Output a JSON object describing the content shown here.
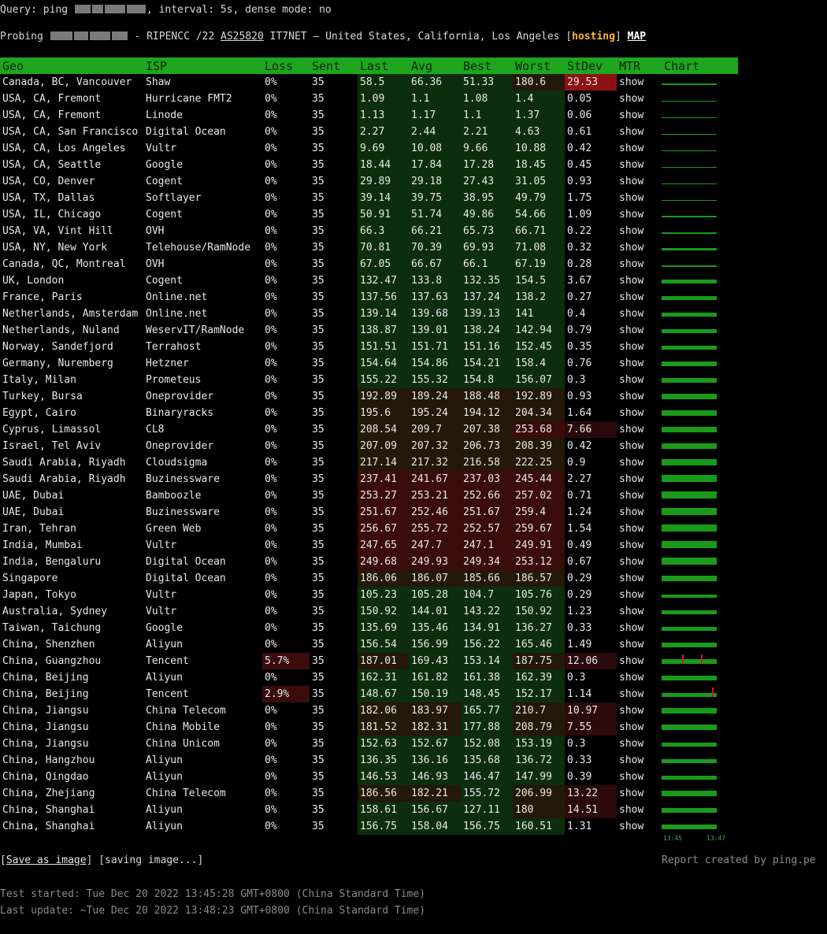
{
  "query": {
    "prefix": "Query: ping ",
    "suffix": ", interval: 5s, dense mode: no"
  },
  "probe": {
    "prefix": "Probing ",
    "network": " - RIPENCC /22 ",
    "asn": "AS25820",
    "org_location": " IT7NET — United States, California, Los Angeles ",
    "lbr": "[",
    "hosting": "hosting",
    "rbr": "]",
    "map": "MAP"
  },
  "headers": [
    "Geo",
    "ISP",
    "Loss",
    "Sent",
    "Last",
    "Avg",
    "Best",
    "Worst",
    "StDev",
    "MTR",
    "Chart"
  ],
  "rows": [
    [
      "Canada, BC, Vancouver",
      "Shaw",
      "0%",
      "35",
      "58.5",
      "66.36",
      "51.33",
      "180.6",
      "29.53"
    ],
    [
      "USA, CA, Fremont",
      "Hurricane FMT2",
      "0%",
      "35",
      "1.09",
      "1.1",
      "1.08",
      "1.4",
      "0.05"
    ],
    [
      "USA, CA, Fremont",
      "Linode",
      "0%",
      "35",
      "1.13",
      "1.17",
      "1.1",
      "1.37",
      "0.06"
    ],
    [
      "USA, CA, San Francisco",
      "Digital Ocean",
      "0%",
      "35",
      "2.27",
      "2.44",
      "2.21",
      "4.63",
      "0.61"
    ],
    [
      "USA, CA, Los Angeles",
      "Vultr",
      "0%",
      "35",
      "9.69",
      "10.08",
      "9.66",
      "10.88",
      "0.42"
    ],
    [
      "USA, CA, Seattle",
      "Google",
      "0%",
      "35",
      "18.44",
      "17.84",
      "17.28",
      "18.45",
      "0.45"
    ],
    [
      "USA, CO, Denver",
      "Cogent",
      "0%",
      "35",
      "29.89",
      "29.18",
      "27.43",
      "31.05",
      "0.93"
    ],
    [
      "USA, TX, Dallas",
      "Softlayer",
      "0%",
      "35",
      "39.14",
      "39.75",
      "38.95",
      "49.79",
      "1.75"
    ],
    [
      "USA, IL, Chicago",
      "Cogent",
      "0%",
      "35",
      "50.91",
      "51.74",
      "49.86",
      "54.66",
      "1.09"
    ],
    [
      "USA, VA, Vint Hill",
      "OVH",
      "0%",
      "35",
      "66.3",
      "66.21",
      "65.73",
      "66.71",
      "0.22"
    ],
    [
      "USA, NY, New York",
      "Telehouse/RamNode",
      "0%",
      "35",
      "70.81",
      "70.39",
      "69.93",
      "71.08",
      "0.32"
    ],
    [
      "Canada, QC, Montreal",
      "OVH",
      "0%",
      "35",
      "67.05",
      "66.67",
      "66.1",
      "67.19",
      "0.28"
    ],
    [
      "UK, London",
      "Cogent",
      "0%",
      "35",
      "132.47",
      "133.8",
      "132.35",
      "154.5",
      "3.67"
    ],
    [
      "France, Paris",
      "Online.net",
      "0%",
      "35",
      "137.56",
      "137.63",
      "137.24",
      "138.2",
      "0.27"
    ],
    [
      "Netherlands, Amsterdam",
      "Online.net",
      "0%",
      "35",
      "139.14",
      "139.68",
      "139.13",
      "141",
      "0.4"
    ],
    [
      "Netherlands, Nuland",
      "WeservIT/RamNode",
      "0%",
      "35",
      "138.87",
      "139.01",
      "138.24",
      "142.94",
      "0.79"
    ],
    [
      "Norway, Sandefjord",
      "Terrahost",
      "0%",
      "35",
      "151.51",
      "151.71",
      "151.16",
      "152.45",
      "0.35"
    ],
    [
      "Germany, Nuremberg",
      "Hetzner",
      "0%",
      "35",
      "154.64",
      "154.86",
      "154.21",
      "158.4",
      "0.76"
    ],
    [
      "Italy, Milan",
      "Prometeus",
      "0%",
      "35",
      "155.22",
      "155.32",
      "154.8",
      "156.07",
      "0.3"
    ],
    [
      "Turkey, Bursa",
      "Oneprovider",
      "0%",
      "35",
      "192.89",
      "189.24",
      "188.48",
      "192.89",
      "0.93"
    ],
    [
      "Egypt, Cairo",
      "Binaryracks",
      "0%",
      "35",
      "195.6",
      "195.24",
      "194.12",
      "204.34",
      "1.64"
    ],
    [
      "Cyprus, Limassol",
      "CL8",
      "0%",
      "35",
      "208.54",
      "209.7",
      "207.38",
      "253.68",
      "7.66"
    ],
    [
      "Israel, Tel Aviv",
      "Oneprovider",
      "0%",
      "35",
      "207.09",
      "207.32",
      "206.73",
      "208.39",
      "0.42"
    ],
    [
      "Saudi Arabia, Riyadh",
      "Cloudsigma",
      "0%",
      "35",
      "217.14",
      "217.32",
      "216.58",
      "222.25",
      "0.9"
    ],
    [
      "Saudi Arabia, Riyadh",
      "Buzinessware",
      "0%",
      "35",
      "237.41",
      "241.67",
      "237.03",
      "245.44",
      "2.27"
    ],
    [
      "UAE, Dubai",
      "Bamboozle",
      "0%",
      "35",
      "253.27",
      "253.21",
      "252.66",
      "257.02",
      "0.71"
    ],
    [
      "UAE, Dubai",
      "Buzinessware",
      "0%",
      "35",
      "251.67",
      "252.46",
      "251.67",
      "259.4",
      "1.24"
    ],
    [
      "Iran, Tehran",
      "Green Web",
      "0%",
      "35",
      "256.67",
      "255.72",
      "252.57",
      "259.67",
      "1.54"
    ],
    [
      "India, Mumbai",
      "Vultr",
      "0%",
      "35",
      "247.65",
      "247.7",
      "247.1",
      "249.91",
      "0.49"
    ],
    [
      "India, Bengaluru",
      "Digital Ocean",
      "0%",
      "35",
      "249.68",
      "249.93",
      "249.34",
      "253.12",
      "0.67"
    ],
    [
      "Singapore",
      "Digital Ocean",
      "0%",
      "35",
      "186.06",
      "186.07",
      "185.66",
      "186.57",
      "0.29"
    ],
    [
      "Japan, Tokyo",
      "Vultr",
      "0%",
      "35",
      "105.23",
      "105.28",
      "104.7",
      "105.76",
      "0.29"
    ],
    [
      "Australia, Sydney",
      "Vultr",
      "0%",
      "35",
      "150.92",
      "144.01",
      "143.22",
      "150.92",
      "1.23"
    ],
    [
      "Taiwan, Taichung",
      "Google",
      "0%",
      "35",
      "135.69",
      "135.46",
      "134.91",
      "136.27",
      "0.33"
    ],
    [
      "China, Shenzhen",
      "Aliyun",
      "0%",
      "35",
      "156.54",
      "156.99",
      "156.22",
      "165.46",
      "1.49"
    ],
    [
      "China, Guangzhou",
      "Tencent",
      "5.7%",
      "35",
      "187.01",
      "169.43",
      "153.14",
      "187.75",
      "12.06"
    ],
    [
      "China, Beijing",
      "Aliyun",
      "0%",
      "35",
      "162.31",
      "161.82",
      "161.38",
      "162.39",
      "0.3"
    ],
    [
      "China, Beijing",
      "Tencent",
      "2.9%",
      "35",
      "148.67",
      "150.19",
      "148.45",
      "152.17",
      "1.14"
    ],
    [
      "China, Jiangsu",
      "China Telecom",
      "0%",
      "35",
      "182.06",
      "183.97",
      "165.77",
      "210.7",
      "10.97"
    ],
    [
      "China, Jiangsu",
      "China Mobile",
      "0%",
      "35",
      "181.52",
      "182.31",
      "177.88",
      "208.79",
      "7.55"
    ],
    [
      "China, Jiangsu",
      "China Unicom",
      "0%",
      "35",
      "152.63",
      "152.67",
      "152.08",
      "153.19",
      "0.3"
    ],
    [
      "China, Hangzhou",
      "Aliyun",
      "0%",
      "35",
      "136.35",
      "136.16",
      "135.68",
      "136.72",
      "0.33"
    ],
    [
      "China, Qingdao",
      "Aliyun",
      "0%",
      "35",
      "146.53",
      "146.93",
      "146.47",
      "147.99",
      "0.39"
    ],
    [
      "China, Zhejiang",
      "China Telecom",
      "0%",
      "35",
      "186.56",
      "182.21",
      "155.72",
      "206.99",
      "13.22"
    ],
    [
      "China, Shanghai",
      "Aliyun",
      "0%",
      "35",
      "158.61",
      "156.67",
      "127.11",
      "180",
      "14.51"
    ],
    [
      "China, Shanghai",
      "Aliyun",
      "0%",
      "35",
      "156.75",
      "158.04",
      "156.75",
      "160.51",
      "1.31"
    ]
  ],
  "mtr_label": "show",
  "chart_ticks": [
    "13:45",
    "13:47"
  ],
  "footer": {
    "save_link": "Save as image",
    "saving": "[saving image...]",
    "report": "Report created by ping.pe",
    "started": "Test started: Tue Dec 20 2022 13:45:28 GMT+0800 (China Standard Time)",
    "updated": "Last update: ~Tue Dec 20 2022 13:48:23 GMT+0800 (China Standard Time)"
  },
  "colors": {
    "header_bg": "#1ea61e",
    "mtr_link": "#27c427",
    "hosting": "#ffb52e",
    "loss_bg": "#3a0c0c",
    "stdev_high_bg": "#8c1212"
  }
}
